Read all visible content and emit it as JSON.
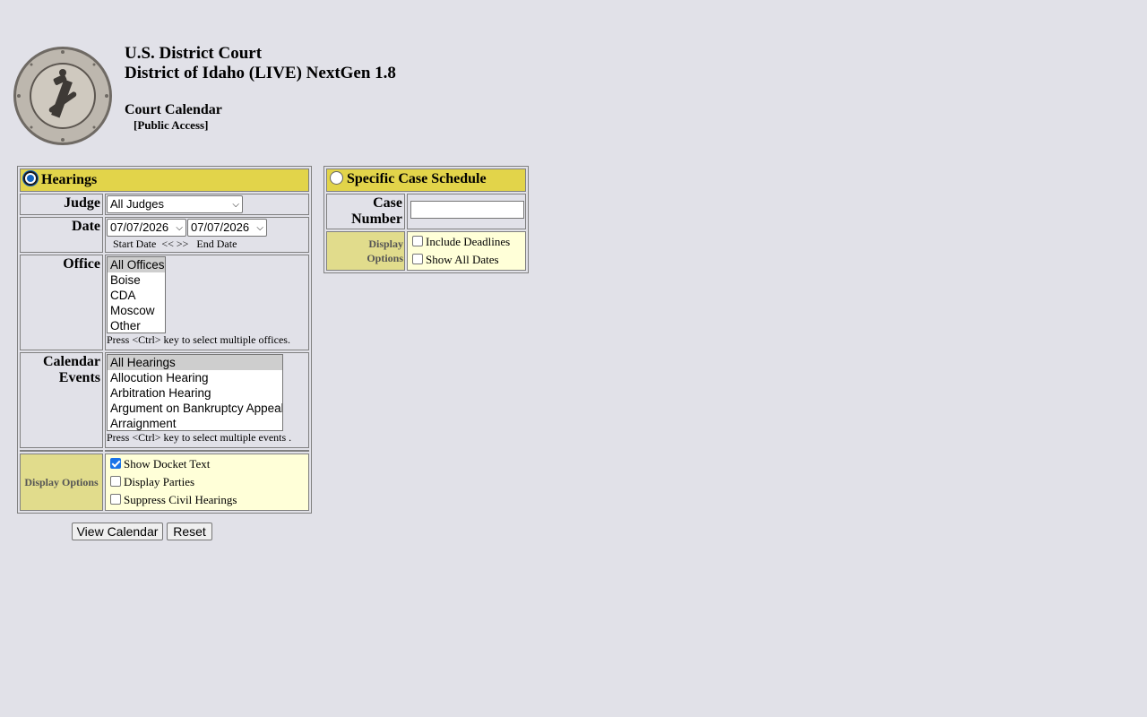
{
  "header": {
    "court_name": "U.S. District Court",
    "district": "District of Idaho (LIVE) NextGen 1.8",
    "page_title": "Court Calendar",
    "access_note": "[Public Access]"
  },
  "hearings": {
    "section_title": "Hearings",
    "selected": true,
    "judge_label": "Judge",
    "judge_value": "All Judges",
    "date_label": "Date",
    "start_date": "07/07/2026",
    "end_date": "07/07/2026",
    "start_date_label": "Start Date",
    "prev_label": "<<",
    "next_label": ">>",
    "end_date_label": "End Date",
    "office_label": "Office",
    "offices": [
      "All Offices",
      "Boise",
      "CDA",
      "Moscow",
      "Other"
    ],
    "offices_selected": "All Offices",
    "office_hint": "Press <Ctrl> key to select multiple offices.",
    "events_label_1": "Calendar",
    "events_label_2": "Events",
    "events": [
      "All Hearings",
      "Allocution Hearing",
      "Arbitration Hearing",
      "Argument on Bankruptcy Appeal",
      "Arraignment"
    ],
    "events_selected": "All Hearings",
    "events_hint": "Press <Ctrl> key to select multiple events .",
    "display_options_label": "Display Options",
    "options": [
      {
        "label": "Show Docket Text",
        "checked": true
      },
      {
        "label": "Display Parties",
        "checked": false
      },
      {
        "label": "Suppress Civil Hearings",
        "checked": false
      }
    ]
  },
  "case_schedule": {
    "section_title": "Specific Case Schedule",
    "selected": false,
    "case_label_1": "Case",
    "case_label_2": "Number",
    "case_number_value": "",
    "display_label_1": "Display",
    "display_label_2": "Options",
    "options": [
      {
        "label": "Include Deadlines",
        "checked": false
      },
      {
        "label": "Show All Dates",
        "checked": false
      }
    ]
  },
  "buttons": {
    "view_calendar": "View Calendar",
    "reset": "Reset"
  },
  "icons": {
    "seal": "court-seal-icon"
  }
}
